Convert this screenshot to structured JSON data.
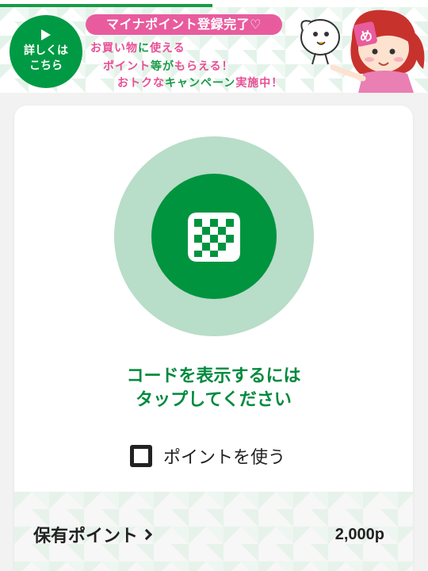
{
  "banner": {
    "details_label": "詳しくは\nこちら",
    "pill_text": "マイナポイント登録完了♡",
    "line1": [
      {
        "t": "お買い物",
        "c": "pk"
      },
      {
        "t": "に",
        "c": "gr"
      },
      {
        "t": "使える",
        "c": "pk"
      }
    ],
    "line2": [
      {
        "t": "ポイント",
        "c": "pk"
      },
      {
        "t": "等が",
        "c": "gr"
      },
      {
        "t": "もらえる！",
        "c": "pk"
      }
    ],
    "line3": [
      {
        "t": "おトクな",
        "c": "pk"
      },
      {
        "t": "キャンペーン",
        "c": "gr"
      },
      {
        "t": "実施中！",
        "c": "pk"
      }
    ],
    "mascot_badge": "め"
  },
  "code": {
    "prompt": "コードを表示するには\nタップしてください",
    "icon": "code-icon"
  },
  "use_points": {
    "label": "ポイントを使う",
    "checked": false
  },
  "points": {
    "label": "保有ポイント",
    "value": "2,000p"
  },
  "colors": {
    "brand_green": "#009a44",
    "pale_green": "#b8ddc8",
    "pink": "#e85c9e",
    "text_dark": "#222222"
  }
}
